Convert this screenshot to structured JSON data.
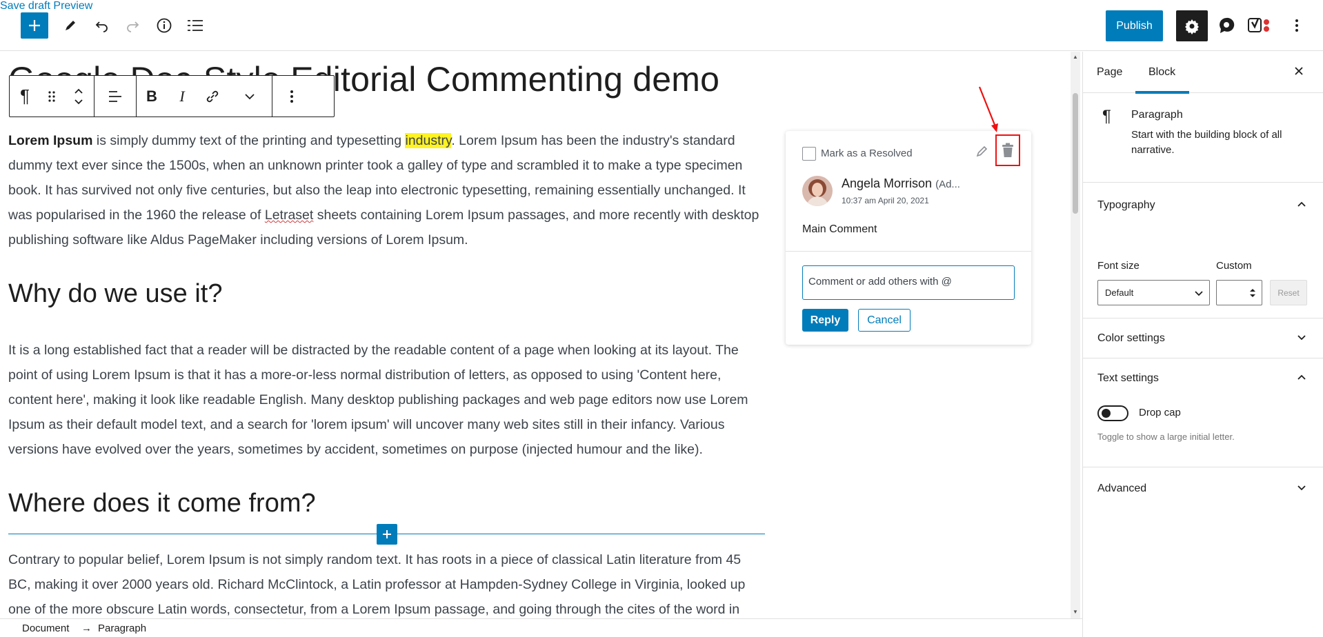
{
  "topbar": {
    "add_label": "+",
    "save_draft": "Save draft",
    "preview": "Preview",
    "publish": "Publish"
  },
  "editor": {
    "title": "Google Doc-Style Editorial Commenting demo",
    "p1_bold": "Lorem Ipsum",
    "p1_a": " is simply dummy text of the printing and typesetting ",
    "p1_highlight": "industry",
    "p1_b": ". Lorem Ipsum has been the industry's standard dummy text ever since the 1500s, when an unknown printer took a galley of type and scrambled it to make a type specimen book. It has survived not only five centuries, but also the leap into electronic typesetting, remaining essentially unchanged. It was popularised in the 1960 the release of ",
    "p1_letraset": "Letraset",
    "p1_c": " sheets containing Lorem Ipsum passages, and more recently with desktop publishing software like Aldus PageMaker including versions of Lorem Ipsum.",
    "h2_1": "Why do we use it?",
    "p2": "It is a long established fact that a reader will be distracted by the readable content of a page when looking at its layout. The point of using Lorem Ipsum is that it has a more-or-less normal distribution of letters, as opposed to using 'Content here, content here', making it look like readable English. Many desktop publishing packages and web page editors now use Lorem Ipsum as their default model text, and a search for 'lorem ipsum' will uncover many web sites still in their infancy. Various versions have evolved over the years, sometimes by accident, sometimes on purpose (injected humour and the like).",
    "h2_2": "Where does it come from?",
    "p3": "Contrary to popular belief, Lorem Ipsum is not simply random text. It has roots in a piece of classical Latin literature from 45 BC, making it over 2000 years old. Richard McClintock, a Latin professor at Hampden-Sydney College in Virginia, looked up one of the more obscure Latin words, consectetur, from a Lorem Ipsum passage, and going through the cites of the word in"
  },
  "comment": {
    "resolve_label": "Mark as a Resolved",
    "author": "Angela Morrison",
    "role": "(Ad...",
    "time": "10:37 am April 20, 2021",
    "text": "Main Comment",
    "input_placeholder": "Comment or add others with @",
    "reply": "Reply",
    "cancel": "Cancel"
  },
  "sidebar": {
    "tab_page": "Page",
    "tab_block": "Block",
    "block_name": "Paragraph",
    "block_desc": "Start with the building block of all narrative.",
    "typography": "Typography",
    "font_size_label": "Font size",
    "custom_label": "Custom",
    "font_size_value": "Default",
    "reset": "Reset",
    "color_settings": "Color settings",
    "text_settings": "Text settings",
    "drop_cap": "Drop cap",
    "drop_cap_help": "Toggle to show a large initial letter.",
    "advanced": "Advanced"
  },
  "footer": {
    "document": "Document",
    "arrow": "→",
    "paragraph": "Paragraph"
  },
  "colors": {
    "accent": "#007cba",
    "highlight": "#fff321",
    "annotation": "#e11"
  }
}
